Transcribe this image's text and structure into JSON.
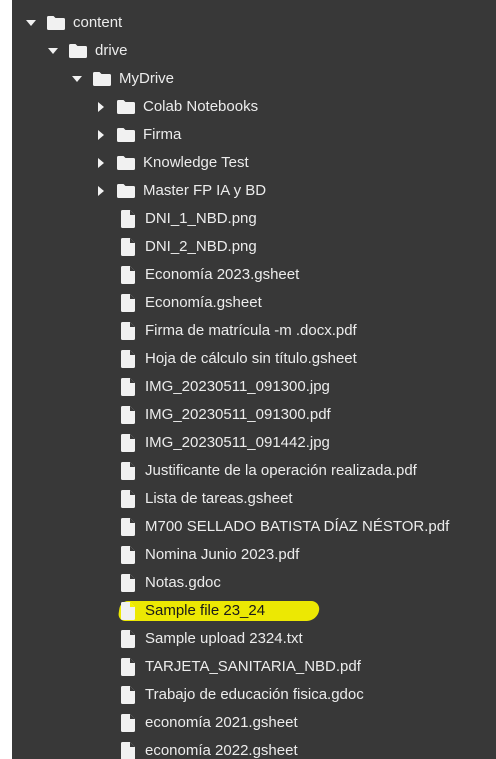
{
  "tree": {
    "root": {
      "label": "content",
      "expanded": true
    },
    "drive": {
      "label": "drive",
      "expanded": true
    },
    "mydrive": {
      "label": "MyDrive",
      "expanded": true
    },
    "folders": [
      {
        "label": "Colab Notebooks",
        "expanded": false
      },
      {
        "label": "Firma",
        "expanded": false
      },
      {
        "label": "Knowledge Test",
        "expanded": false
      },
      {
        "label": "Master FP IA y BD",
        "expanded": false
      }
    ],
    "files": [
      {
        "label": "DNI_1_NBD.png"
      },
      {
        "label": "DNI_2_NBD.png"
      },
      {
        "label": "Economía 2023.gsheet"
      },
      {
        "label": "Economía.gsheet"
      },
      {
        "label": "Firma de matrícula -m .docx.pdf"
      },
      {
        "label": "Hoja de cálculo sin título.gsheet"
      },
      {
        "label": "IMG_20230511_091300.jpg"
      },
      {
        "label": "IMG_20230511_091300.pdf"
      },
      {
        "label": "IMG_20230511_091442.jpg"
      },
      {
        "label": "Justificante de la operación realizada.pdf"
      },
      {
        "label": "Lista de tareas.gsheet"
      },
      {
        "label": "M700 SELLADO BATISTA DÍAZ NÉSTOR.pdf"
      },
      {
        "label": "Nomina Junio 2023.pdf"
      },
      {
        "label": "Notas.gdoc"
      },
      {
        "label": "Sample file 23_24",
        "highlighted": true
      },
      {
        "label": "Sample upload 2324.txt"
      },
      {
        "label": "TARJETA_SANITARIA_NBD.pdf"
      },
      {
        "label": "Trabajo de educación fisica.gdoc"
      },
      {
        "label": "economía 2021.gsheet"
      },
      {
        "label": "economía 2022.gsheet"
      }
    ]
  },
  "colors": {
    "panel_bg": "#383838",
    "text": "#ececec",
    "icon": "#f1f1f1",
    "highlight": "#f5f100"
  }
}
